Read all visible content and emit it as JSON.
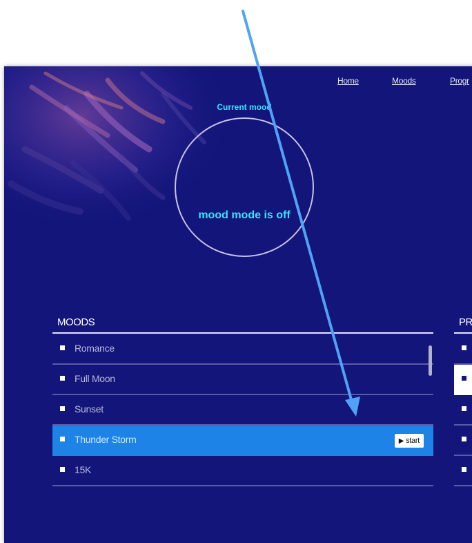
{
  "nav": {
    "home": "Home",
    "moods": "Moods",
    "programs": "Progr"
  },
  "current_mood": {
    "label": "Current mood",
    "status": "mood mode is off"
  },
  "moods": {
    "title": "MOODS",
    "items": [
      {
        "label": "Romance"
      },
      {
        "label": "Full Moon"
      },
      {
        "label": "Sunset"
      },
      {
        "label": "Thunder Storm",
        "active": true
      },
      {
        "label": "15K"
      }
    ],
    "start_label": "start"
  },
  "programs": {
    "title": "PR"
  },
  "colors": {
    "background": "#13157a",
    "accent_cyan": "#35e6ff",
    "active_row": "#1d83e6",
    "arrow": "#4ea3f5"
  }
}
